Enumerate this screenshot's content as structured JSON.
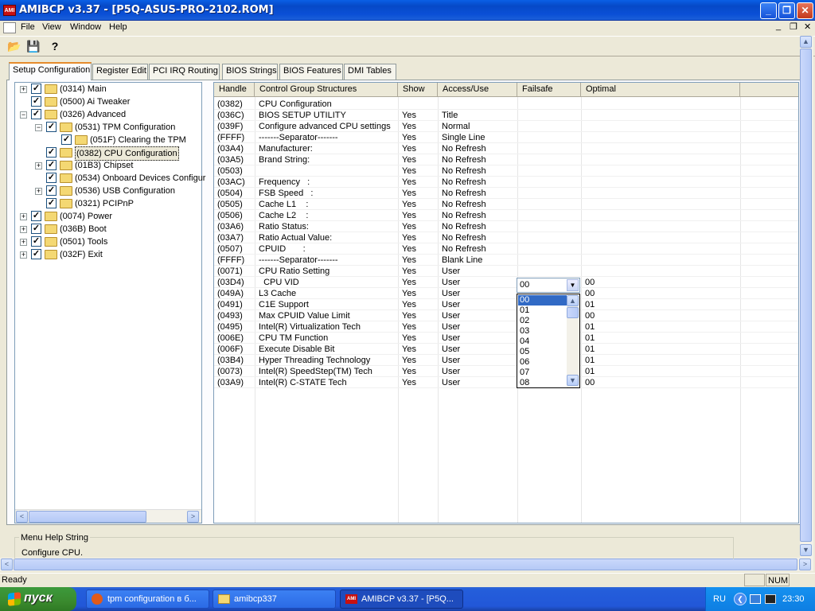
{
  "window": {
    "title": "AMIBCP v3.37 - [P5Q-ASUS-PRO-2102.ROM]",
    "app_icon_text": "AMI",
    "btn_min": "_",
    "btn_max": "❐",
    "btn_close": "✕"
  },
  "menu": {
    "items": [
      "File",
      "View",
      "Window",
      "Help"
    ],
    "doc_min": "_",
    "doc_restore": "❐",
    "doc_close": "✕"
  },
  "toolbar": {
    "open_icon": "📂",
    "save_icon": "💾",
    "help_icon": "?"
  },
  "tabs": [
    "Setup Configuration",
    "Register Edit",
    "PCI IRQ Routing",
    "BIOS Strings",
    "BIOS Features",
    "DMI Tables"
  ],
  "tree": [
    {
      "label": "(0314) Main",
      "level": 0,
      "expander": "+",
      "checked": true
    },
    {
      "label": "(0500) Ai Tweaker",
      "level": 0,
      "expander": "",
      "checked": true
    },
    {
      "label": "(0326) Advanced",
      "level": 0,
      "expander": "−",
      "checked": true
    },
    {
      "label": "(0531) TPM Configuration",
      "level": 1,
      "expander": "−",
      "checked": true
    },
    {
      "label": "(051F) Clearing the TPM",
      "level": 2,
      "expander": "",
      "checked": true
    },
    {
      "label": "(0382) CPU Configuration",
      "level": 1,
      "expander": "",
      "checked": true,
      "selected": true
    },
    {
      "label": "(01B3) Chipset",
      "level": 1,
      "expander": "+",
      "checked": true
    },
    {
      "label": "(0534) Onboard Devices Configur",
      "level": 1,
      "expander": "",
      "checked": true
    },
    {
      "label": "(0536) USB Configuration",
      "level": 1,
      "expander": "+",
      "checked": true
    },
    {
      "label": "(0321) PCIPnP",
      "level": 1,
      "expander": "",
      "checked": true
    },
    {
      "label": "(0074) Power",
      "level": 0,
      "expander": "+",
      "checked": true
    },
    {
      "label": "(036B) Boot",
      "level": 0,
      "expander": "+",
      "checked": true
    },
    {
      "label": "(0501) Tools",
      "level": 0,
      "expander": "+",
      "checked": true
    },
    {
      "label": "(032F) Exit",
      "level": 0,
      "expander": "+",
      "checked": true
    }
  ],
  "grid": {
    "columns": [
      "Handle",
      "Control Group Structures",
      "Show",
      "Access/Use",
      "Failsafe",
      "Optimal"
    ],
    "rows": [
      [
        "(0382)",
        "CPU Configuration",
        "",
        "",
        "",
        ""
      ],
      [
        "(036C)",
        "BIOS SETUP UTILITY",
        "Yes",
        "Title",
        "",
        ""
      ],
      [
        "(039F)",
        "Configure advanced CPU settings",
        "Yes",
        "Normal",
        "",
        ""
      ],
      [
        "(FFFF)",
        "-------Separator-------",
        "Yes",
        "Single Line",
        "",
        ""
      ],
      [
        "(03A4)",
        "Manufacturer:",
        "Yes",
        "No Refresh",
        "",
        ""
      ],
      [
        "(03A5)",
        "Brand String:",
        "Yes",
        "No Refresh",
        "",
        ""
      ],
      [
        "(0503)",
        "",
        "Yes",
        "No Refresh",
        "",
        ""
      ],
      [
        "(03AC)",
        "Frequency   :",
        "Yes",
        "No Refresh",
        "",
        ""
      ],
      [
        "(0504)",
        "FSB Speed   :",
        "Yes",
        "No Refresh",
        "",
        ""
      ],
      [
        "(0505)",
        "Cache L1    :",
        "Yes",
        "No Refresh",
        "",
        ""
      ],
      [
        "(0506)",
        "Cache L2    :",
        "Yes",
        "No Refresh",
        "",
        ""
      ],
      [
        "(03A6)",
        "Ratio Status:",
        "Yes",
        "No Refresh",
        "",
        ""
      ],
      [
        "(03A7)",
        "Ratio Actual Value:",
        "Yes",
        "No Refresh",
        "",
        ""
      ],
      [
        "(0507)",
        "CPUID       :",
        "Yes",
        "No Refresh",
        "",
        ""
      ],
      [
        "(FFFF)",
        "-------Separator-------",
        "Yes",
        "Blank Line",
        "",
        ""
      ],
      [
        "(0071)",
        "CPU Ratio Setting",
        "Yes",
        "User",
        "",
        ""
      ],
      [
        "(03D4)",
        "  CPU VID",
        "Yes",
        "User",
        "",
        "00"
      ],
      [
        "(049A)",
        "L3 Cache",
        "Yes",
        "User",
        "",
        "00"
      ],
      [
        "(0491)",
        "C1E Support",
        "Yes",
        "User",
        "",
        "01"
      ],
      [
        "(0493)",
        "Max CPUID Value Limit",
        "Yes",
        "User",
        "",
        "00"
      ],
      [
        "(0495)",
        "Intel(R) Virtualization Tech",
        "Yes",
        "User",
        "",
        "01"
      ],
      [
        "(006E)",
        "CPU TM Function",
        "Yes",
        "User",
        "",
        "01"
      ],
      [
        "(006F)",
        "Execute Disable Bit",
        "Yes",
        "User",
        "",
        "01"
      ],
      [
        "(03B4)",
        "Hyper Threading Technology",
        "Yes",
        "User",
        "",
        "01"
      ],
      [
        "(0073)",
        "Intel(R) SpeedStep(TM) Tech",
        "Yes",
        "User",
        "",
        "01"
      ],
      [
        "(03A9)",
        "Intel(R) C-STATE Tech",
        "Yes",
        "User",
        "",
        "00"
      ]
    ]
  },
  "dropdown": {
    "value": "00",
    "options": [
      "00",
      "01",
      "02",
      "03",
      "04",
      "05",
      "06",
      "07",
      "08"
    ],
    "highlighted": "00"
  },
  "help": {
    "title": "Menu Help String",
    "text": "Configure CPU."
  },
  "status": {
    "text": "Ready",
    "num": "NUM"
  },
  "taskbar": {
    "start": "пуск",
    "tasks": [
      "tpm configuration в б...",
      "amibcp337",
      "AMIBCP v3.37 - [P5Q..."
    ],
    "lang": "RU",
    "time": "23:30"
  }
}
